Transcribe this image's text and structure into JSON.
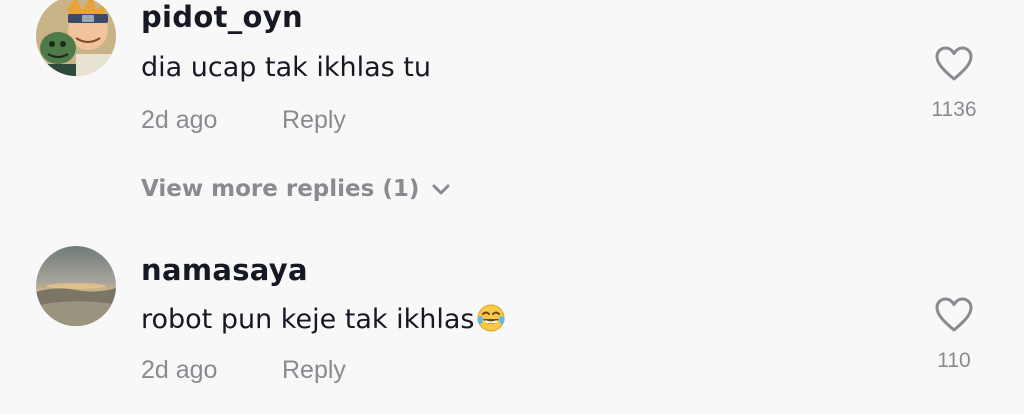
{
  "comments": [
    {
      "username": "pidot_oyn",
      "text": "dia ucap tak ikhlas tu",
      "time": "2d ago",
      "reply_label": "Reply",
      "likes": "1136"
    },
    {
      "username": "namasaya",
      "text": "robot pun keje tak ikhlas",
      "emoji": "face-with-tears-of-joy",
      "time": "2d ago",
      "reply_label": "Reply",
      "likes": "110"
    }
  ],
  "view_more_label": "View more replies (1)",
  "colors": {
    "background": "#f8f8f8",
    "primary_text": "#161823",
    "secondary_text": "#8a8b91"
  }
}
